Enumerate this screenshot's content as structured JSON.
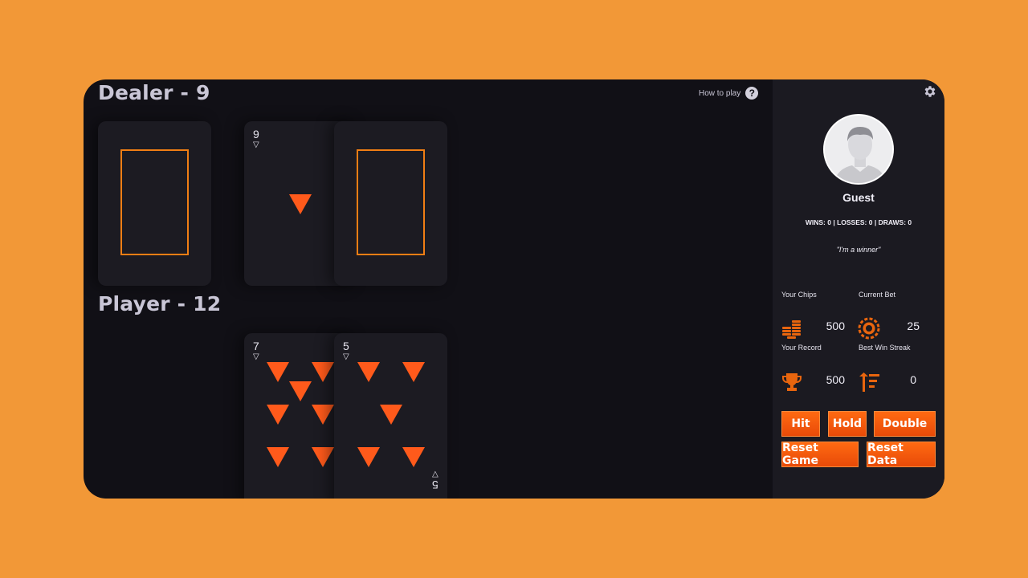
{
  "dealer": {
    "title": "Dealer - 9"
  },
  "player": {
    "title": "Player - 12"
  },
  "help": {
    "label": "How to play",
    "icon": "?"
  },
  "cards": {
    "dealer_card_2": {
      "rank": "9",
      "suit": "▽"
    },
    "player_card_1": {
      "rank": "7",
      "suit": "▽"
    },
    "player_card_2": {
      "rank": "5",
      "suit": "▽"
    }
  },
  "profile": {
    "name": "Guest",
    "record": "WINS: 0 | LOSSES: 0 | DRAWS: 0",
    "quote": "\"I'm a winner\""
  },
  "stats": {
    "chips_label": "Your Chips",
    "chips_value": "500",
    "bet_label": "Current Bet",
    "bet_value": "25",
    "record_label": "Your Record",
    "record_value": "500",
    "streak_label": "Best Win Streak",
    "streak_value": "0"
  },
  "buttons": {
    "hit": "Hit",
    "hold": "Hold",
    "double": "Double",
    "reset_game": "Reset Game",
    "reset_data": "Reset Data"
  },
  "colors": {
    "accent": "#FF5A1B",
    "background": "#F29837",
    "table": "#111016",
    "sidebar": "#1B1A21"
  }
}
